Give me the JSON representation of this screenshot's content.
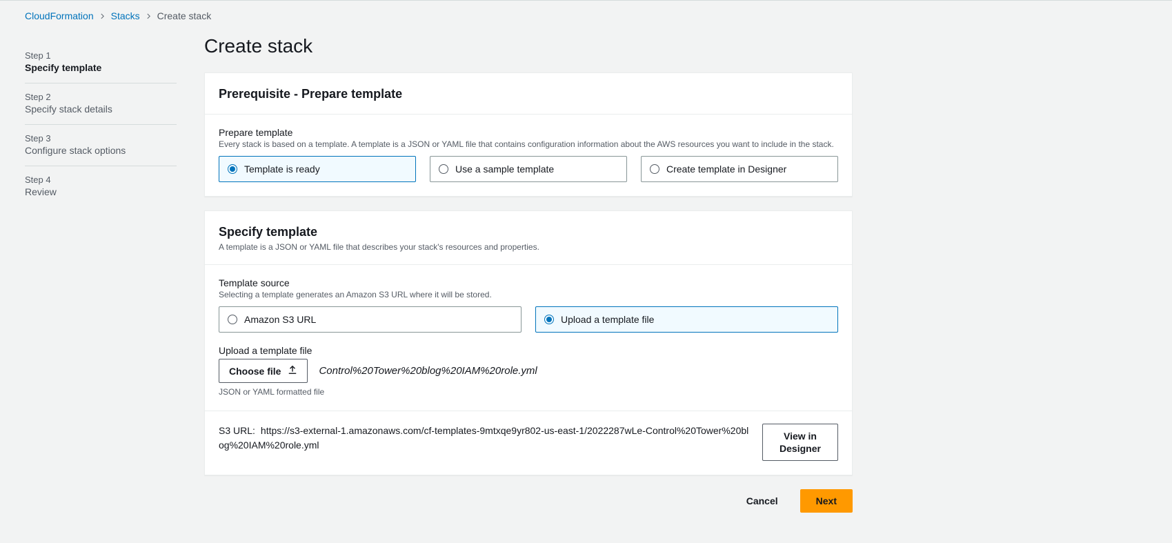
{
  "breadcrumb": {
    "items": [
      "CloudFormation",
      "Stacks"
    ],
    "current": "Create stack"
  },
  "steps": [
    {
      "num": "Step 1",
      "name": "Specify template",
      "active": true
    },
    {
      "num": "Step 2",
      "name": "Specify stack details",
      "active": false
    },
    {
      "num": "Step 3",
      "name": "Configure stack options",
      "active": false
    },
    {
      "num": "Step 4",
      "name": "Review",
      "active": false
    }
  ],
  "page_title": "Create stack",
  "panel1": {
    "title": "Prerequisite - Prepare template",
    "field_label": "Prepare template",
    "field_help": "Every stack is based on a template. A template is a JSON or YAML file that contains configuration information about the AWS resources you want to include in the stack.",
    "options": {
      "ready": "Template is ready",
      "sample": "Use a sample template",
      "designer": "Create template in Designer"
    }
  },
  "panel2": {
    "title": "Specify template",
    "subtitle": "A template is a JSON or YAML file that describes your stack's resources and properties.",
    "source_label": "Template source",
    "source_help": "Selecting a template generates an Amazon S3 URL where it will be stored.",
    "options": {
      "s3": "Amazon S3 URL",
      "upload": "Upload a template file"
    },
    "upload_label": "Upload a template file",
    "choose_label": "Choose file",
    "filename": "Control%20Tower%20blog%20IAM%20role.yml",
    "hint": "JSON or YAML formatted file",
    "s3_label": "S3 URL:",
    "s3_url": "https://s3-external-1.amazonaws.com/cf-templates-9mtxqe9yr802-us-east-1/2022287wLe-Control%20Tower%20blog%20IAM%20role.yml",
    "view_designer": "View in Designer"
  },
  "actions": {
    "cancel": "Cancel",
    "next": "Next"
  }
}
